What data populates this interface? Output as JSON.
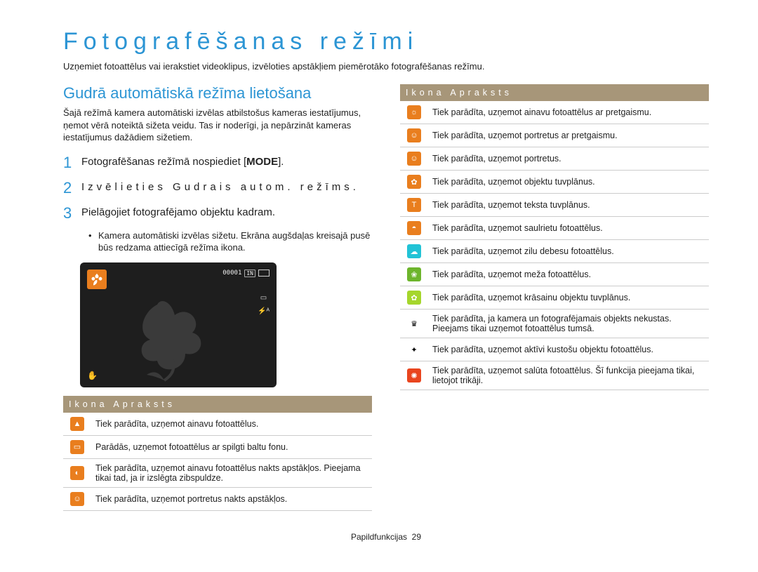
{
  "title": "Fotografēšanas režīmi",
  "intro": "Uzņemiet fotoattēlus vai ierakstiet videoklipus, izvēloties apstākļiem piemērotāko fotografēšanas režīmu.",
  "section_title": "Gudrā automātiskā režīma lietošana",
  "section_desc": "Šajā režīmā kamera automātiski izvēlas atbilstošus kameras iestatījumus, ņemot vērā noteiktā sižeta veidu. Tas ir noderīgi, ja nepārzināt kameras iestatījumus dažādiem sižetiem.",
  "steps": [
    {
      "n": "1",
      "txt": "Fotografēšanas režīmā nospiediet [",
      "mode": "MODE",
      "tail": "]."
    },
    {
      "n": "2",
      "txt": "Izvēlieties Gudrais autom. režīms."
    },
    {
      "n": "3",
      "txt": "Pielāgojiet fotografējamo objektu kadram."
    }
  ],
  "note": "Kamera automātiski izvēlas sižetu. Ekrāna augšdaļas kreisajā pusē būs redzama attiecīgā režīma ikona.",
  "lcd": {
    "counter": "00001",
    "mem": "IN"
  },
  "th": "Ikona Apraksts",
  "left_rows": [
    {
      "label": "Tiek parādīta, uzņemot ainavu fotoattēlus."
    },
    {
      "label": "Parādās, uzņemot fotoattēlus ar spilgti baltu fonu."
    },
    {
      "label": "Tiek parādīta, uzņemot ainavu fotoattēlus nakts apstākļos. Pieejama tikai tad, ja ir izslēgta zibspuldze."
    },
    {
      "label": "Tiek parādīta, uzņemot portretus nakts apstākļos."
    }
  ],
  "right_rows": [
    {
      "label": "Tiek parādīta, uzņemot ainavu fotoattēlus ar pretgaismu."
    },
    {
      "label": "Tiek parādīta, uzņemot portretus ar pretgaismu."
    },
    {
      "label": "Tiek parādīta, uzņemot portretus."
    },
    {
      "label": "Tiek parādīta, uzņemot objektu tuvplānus."
    },
    {
      "label": "Tiek parādīta, uzņemot teksta tuvplānus."
    },
    {
      "label": "Tiek parādīta, uzņemot saulrietu fotoattēlus."
    },
    {
      "label": "Tiek parādīta, uzņemot zilu debesu fotoattēlus."
    },
    {
      "label": "Tiek parādīta, uzņemot meža fotoattēlus."
    },
    {
      "label": "Tiek parādīta, uzņemot krāsainu objektu tuvplānus."
    },
    {
      "label": "Tiek parādīta, ja kamera un fotografējamais objekts nekustas. Pieejams tikai uzņemot fotoattēlus tumsā."
    },
    {
      "label": "Tiek parādīta, uzņemot aktīvi kustošu objektu fotoattēlus."
    },
    {
      "label": "Tiek parādīta, uzņemot salūta fotoattēlus. Šī funkcija pieejama tikai, lietojot trikāji."
    }
  ],
  "footer_label": "Papildfunkcijas",
  "footer_page": "29"
}
